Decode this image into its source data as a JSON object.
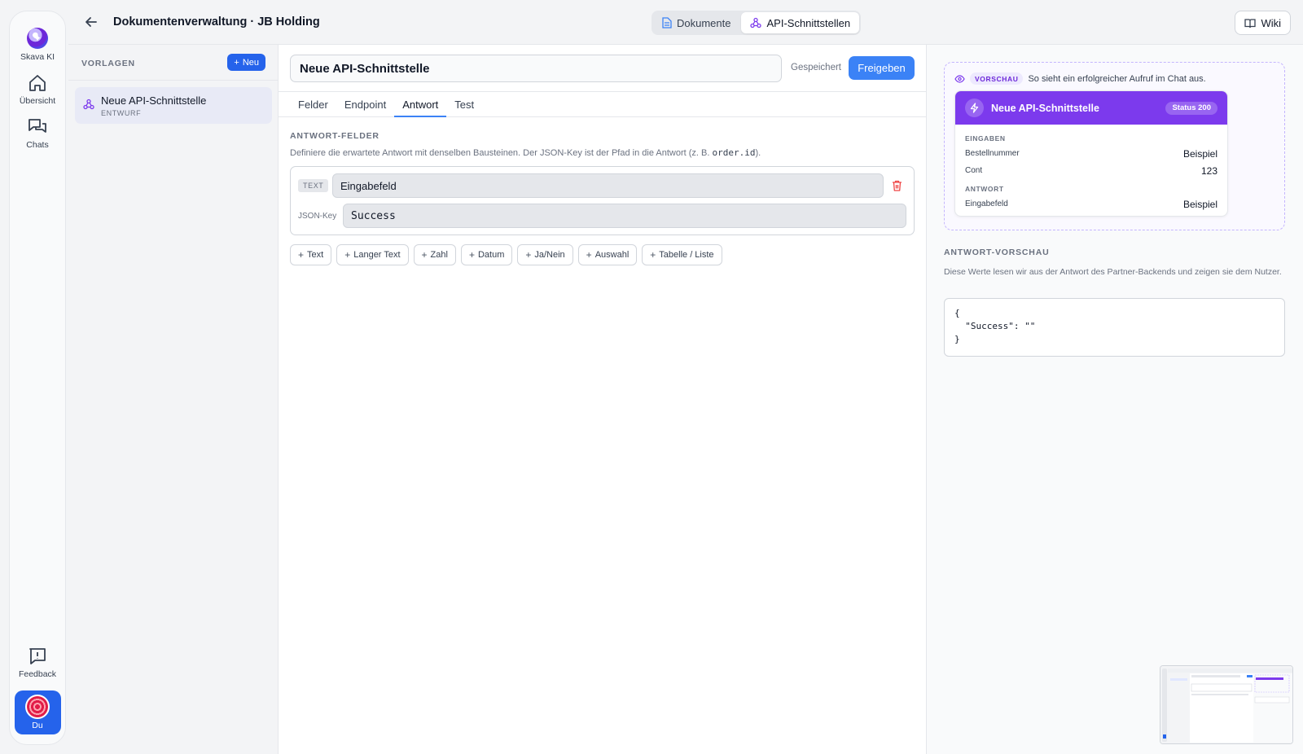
{
  "rail": {
    "logo_label": "Skava KI",
    "items": [
      {
        "label": "Übersicht",
        "icon": "home-icon"
      },
      {
        "label": "Chats",
        "icon": "chats-icon"
      }
    ],
    "feedback_label": "Feedback",
    "user_label": "Du"
  },
  "header": {
    "title": "Dokumentenverwaltung · JB Holding",
    "switcher": [
      {
        "label": "Dokumente",
        "icon": "document-icon",
        "active": false
      },
      {
        "label": "API-Schnittstellen",
        "icon": "webhook-icon",
        "active": true
      }
    ],
    "wiki_label": "Wiki"
  },
  "templates": {
    "heading": "VORLAGEN",
    "new_label": "Neu",
    "items": [
      {
        "name": "Neue API-Schnittstelle",
        "status": "ENTWURF"
      }
    ]
  },
  "editor": {
    "title_value": "Neue API-Schnittstelle",
    "saved_label": "Gespeichert",
    "publish_label": "Freigeben",
    "tabs": [
      "Felder",
      "Endpoint",
      "Antwort",
      "Test"
    ],
    "active_tab": "Antwort",
    "section_heading": "ANTWORT-FELDER",
    "section_desc_before": "Definiere die erwartete Antwort mit denselben Bausteinen. Der JSON-Key ist der Pfad in die Antwort (z. B. ",
    "section_desc_code": "order.id",
    "section_desc_after": ").",
    "field": {
      "type_badge": "TEXT",
      "name_value": "Eingabefeld",
      "key_label": "JSON-Key",
      "key_value": "Success"
    },
    "add_buttons": [
      "Text",
      "Langer Text",
      "Zahl",
      "Datum",
      "Ja/Nein",
      "Auswahl",
      "Tabelle / Liste"
    ]
  },
  "preview": {
    "badge": "VORSCHAU",
    "hint": "So sieht ein erfolgreicher Aufruf im Chat aus.",
    "card_title": "Neue API-Schnittstelle",
    "status": "Status 200",
    "inputs_heading": "EINGABEN",
    "inputs": [
      {
        "key": "Bestellnummer",
        "value": "Beispiel"
      },
      {
        "key": "Cont",
        "value": "123"
      }
    ],
    "response_heading": "ANTWORT",
    "response": [
      {
        "key": "Eingabefeld",
        "value": "Beispiel"
      }
    ],
    "response_preview_heading": "ANTWORT-VORSCHAU",
    "response_preview_desc": "Diese Werte lesen wir aus der Antwort des Partner-Backends und zeigen sie dem Nutzer.",
    "json_preview": "{\n  \"Success\": \"\"\n}"
  },
  "colors": {
    "accent": "#3b82f6",
    "preview_purple": "#7c3aed",
    "danger": "#ef4444"
  }
}
